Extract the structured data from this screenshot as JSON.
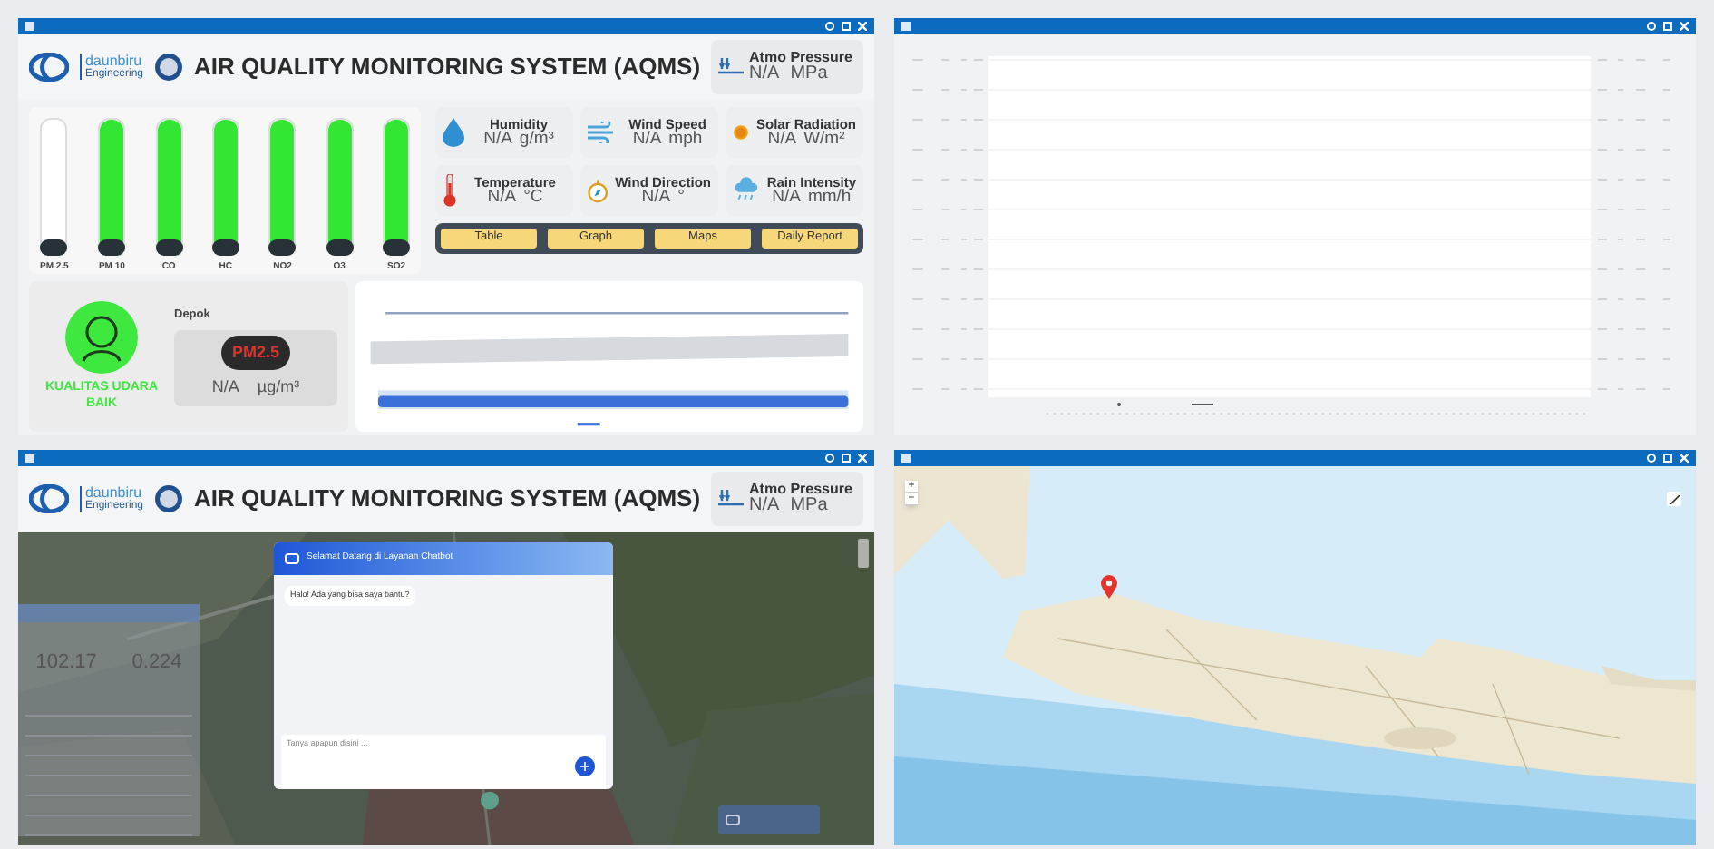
{
  "dashboard": {
    "header": {
      "brand": "daunbiru",
      "brand_sub": "Engineering",
      "title": "AIR QUALITY MONITORING SYSTEM (AQMS)",
      "pressure": {
        "label": "Atmo Pressure",
        "value": "N/A",
        "unit": "MPa"
      }
    },
    "gauges": [
      {
        "label": "PM 2.5",
        "level": 0
      },
      {
        "label": "PM 10",
        "level": 1
      },
      {
        "label": "CO",
        "level": 1
      },
      {
        "label": "HC",
        "level": 1
      },
      {
        "label": "NO2",
        "level": 1
      },
      {
        "label": "O3",
        "level": 1
      },
      {
        "label": "SO2",
        "level": 1
      }
    ],
    "sensors": [
      {
        "kind": "humidity",
        "label": "Humidity",
        "value": "N/A",
        "unit": "g/m³"
      },
      {
        "kind": "wind_speed",
        "label": "Wind Speed",
        "value": "N/A",
        "unit": "mph"
      },
      {
        "kind": "solar",
        "label": "Solar Radiation",
        "value": "N/A",
        "unit": "W/m²"
      },
      {
        "kind": "temperature",
        "label": "Temperature",
        "value": "N/A",
        "unit": "°C"
      },
      {
        "kind": "wind_direction",
        "label": "Wind Direction",
        "value": "N/A",
        "unit": "°"
      },
      {
        "kind": "rain",
        "label": "Rain Intensity",
        "value": "N/A",
        "unit": "mm/h"
      }
    ],
    "nav": [
      "Table",
      "Graph",
      "Maps",
      "Daily Report"
    ],
    "air_quality": {
      "status": "KUALITAS UDARA BAIK",
      "color": "#3ee83e",
      "location": "Depok",
      "pollutant": "PM2.5",
      "value": "N/A",
      "unit": "µg/m³"
    }
  },
  "chatbot_view": {
    "header": {
      "brand": "daunbiru",
      "brand_sub": "Engineering",
      "title": "AIR QUALITY MONITORING SYSTEM (AQMS)",
      "pressure": {
        "label": "Atmo Pressure",
        "value": "N/A",
        "unit": "MPa"
      }
    },
    "readings": [
      "102.17",
      "0.224"
    ],
    "chat": {
      "title": "Selamat Datang di Layanan Chatbot",
      "messages": [
        "Halo! Ada yang bisa saya bantu?"
      ],
      "placeholder": "Tanya apapun disini ..."
    }
  },
  "map_view": {
    "zoom_buttons": [
      "+",
      "−"
    ]
  }
}
